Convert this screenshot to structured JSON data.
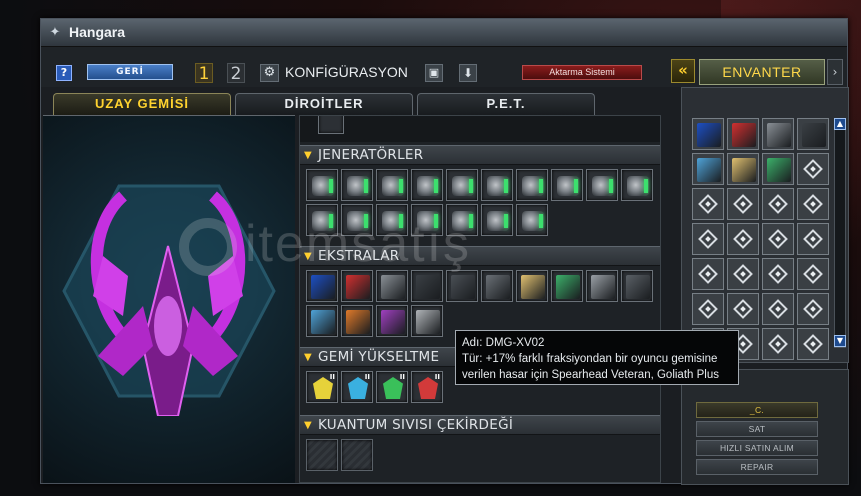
{
  "window": {
    "title": "Hangara",
    "title_icon": "gear-wrench-icon"
  },
  "toolbar": {
    "help_label": "?",
    "back_label": "GERİ",
    "config_1": "1",
    "config_2": "2",
    "config_label": "KONFİGÜRASYON",
    "transfer_label": "Aktarma Sistemi",
    "inventory_label": "ENVANTER",
    "inv_left_arrow": "«",
    "inv_right_arrow": "›"
  },
  "tabs": [
    {
      "label": "UZAY GEMİSİ",
      "active": true
    },
    {
      "label": "DİROİTLER",
      "active": false
    },
    {
      "label": "P.E.T.",
      "active": false
    }
  ],
  "sections": [
    {
      "label": "JENERATÖRLER",
      "slot_count": 17,
      "icon_type": "generator"
    },
    {
      "label": "EKSTRALAR",
      "slot_count": 14,
      "icon_type": "extra"
    },
    {
      "label": "GEMİ YÜKSELTME",
      "slot_count": 4,
      "icon_type": "upgrade"
    },
    {
      "label": "KUANTUM SIVISI ÇEKİRDEĞİ",
      "slot_count": 2,
      "icon_type": "empty"
    }
  ],
  "extras_colors": [
    "#1d4fc4",
    "#d23030",
    "#8a9096",
    "#3a3f44",
    "#4a4f55",
    "#6a7076",
    "#e0c070",
    "#3cb06a",
    "#9aa0a6",
    "#5a6066",
    "#4fa3d8",
    "#e07a2a",
    "#a040c0",
    "#b0b4b8"
  ],
  "upgrade_colors": [
    "#e6d23a",
    "#3ab0e0",
    "#3ac05a",
    "#d23a3a"
  ],
  "upgrade_badge": "II",
  "tooltip": {
    "name_line": "Adı: DMG-XV02",
    "desc_line_1": "Tür: +17% farklı fraksiyondan bir oyuncu gemisine",
    "desc_line_2": "verilen hasar için Spearhead Veteran, Goliath Plus"
  },
  "side_buttons": {
    "credits_label": "_C.",
    "sell_label": "SAT",
    "quick_buy_label": "HIZLI SATIN ALIM",
    "repair_label": "REPAIR"
  },
  "watermark": {
    "text": "itemsatış"
  },
  "colors": {
    "accent_gold": "#ffd32f",
    "ship_magenta": "#d236e6",
    "glow_green": "#3ce06d"
  }
}
